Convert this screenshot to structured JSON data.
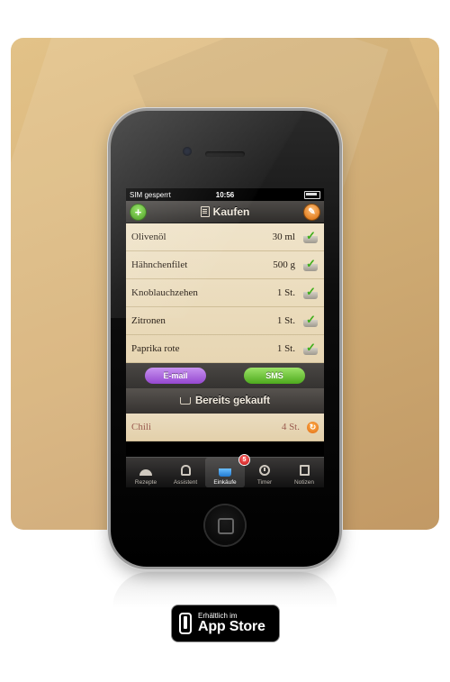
{
  "status_bar": {
    "carrier": "SIM gesperrt",
    "time": "10:56"
  },
  "nav": {
    "title": "Kaufen",
    "add_label": "+",
    "edit_label": "✎"
  },
  "shopping_list": [
    {
      "name": "Olivenöl",
      "qty": "30 ml"
    },
    {
      "name": "Hähnchenfilet",
      "qty": "500 g"
    },
    {
      "name": "Knoblauchzehen",
      "qty": "1 St."
    },
    {
      "name": "Zitronen",
      "qty": "1 St."
    },
    {
      "name": "Paprika rote",
      "qty": "1 St."
    }
  ],
  "actions": {
    "email_label": "E-mail",
    "sms_label": "SMS"
  },
  "bought_section": {
    "title": "Bereits gekauft",
    "items": [
      {
        "name": "Chili",
        "qty": "4 St."
      }
    ]
  },
  "tabbar": {
    "tabs": [
      {
        "label": "Rezepte",
        "icon": "cloche-icon"
      },
      {
        "label": "Assistent",
        "icon": "chef-hat-icon"
      },
      {
        "label": "Einkäufe",
        "icon": "basket-icon",
        "badge": "5",
        "active": true
      },
      {
        "label": "Timer",
        "icon": "clock-icon"
      },
      {
        "label": "Notizen",
        "icon": "notes-icon"
      }
    ]
  },
  "appstore_badge": {
    "line1": "Erhältlich im",
    "line2": "App Store"
  },
  "colors": {
    "accent_green": "#4aa21c",
    "accent_purple": "#9548d0",
    "accent_orange": "#e07a1b",
    "paper": "#efe3c9",
    "background": "#d9b47a"
  }
}
